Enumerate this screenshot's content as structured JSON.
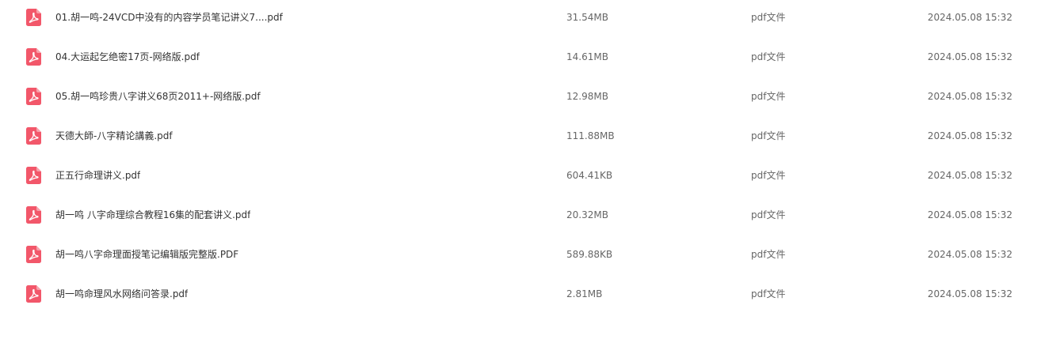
{
  "files": [
    {
      "name": "01.胡一鸣-24VCD中没有的内容学员笔记讲义7....pdf",
      "size": "31.54MB",
      "type": "pdf文件",
      "date": "2024.05.08 15:32",
      "icon": "pdf-file-icon"
    },
    {
      "name": "04.大运起乞绝密17页-网络版.pdf",
      "size": "14.61MB",
      "type": "pdf文件",
      "date": "2024.05.08 15:32",
      "icon": "pdf-file-icon"
    },
    {
      "name": "05.胡一鸣珍贵八字讲义68页2011+-网络版.pdf",
      "size": "12.98MB",
      "type": "pdf文件",
      "date": "2024.05.08 15:32",
      "icon": "pdf-file-icon"
    },
    {
      "name": "天德大師-八字精论講義.pdf",
      "size": "111.88MB",
      "type": "pdf文件",
      "date": "2024.05.08 15:32",
      "icon": "pdf-file-icon"
    },
    {
      "name": "正五行命理讲义.pdf",
      "size": "604.41KB",
      "type": "pdf文件",
      "date": "2024.05.08 15:32",
      "icon": "pdf-file-icon"
    },
    {
      "name": "胡一鸣 八字命理综合教程16集的配套讲义.pdf",
      "size": "20.32MB",
      "type": "pdf文件",
      "date": "2024.05.08 15:32",
      "icon": "pdf-file-icon"
    },
    {
      "name": "胡一鸣八字命理面授笔记编辑版完整版.PDF",
      "size": "589.88KB",
      "type": "pdf文件",
      "date": "2024.05.08 15:32",
      "icon": "pdf-file-icon"
    },
    {
      "name": "胡一鸣命理风水网络问答录.pdf",
      "size": "2.81MB",
      "type": "pdf文件",
      "date": "2024.05.08 15:32",
      "icon": "pdf-file-icon"
    }
  ],
  "colors": {
    "pdf_icon": "#f2576a",
    "name_text": "#333333",
    "meta_text": "#666666"
  }
}
